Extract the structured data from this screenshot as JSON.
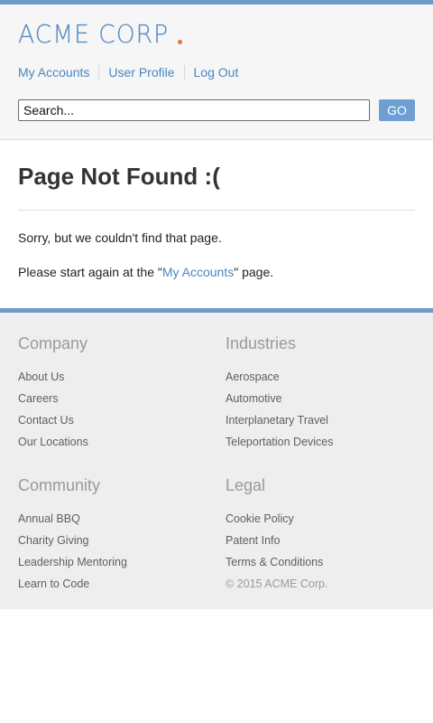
{
  "brand": {
    "name": "ACME CORP",
    "accent": "#6f9bc8",
    "dot_color": "#d9783a"
  },
  "nav": {
    "items": [
      "My Accounts",
      "User Profile",
      "Log Out"
    ]
  },
  "search": {
    "value": "Search...",
    "button_label": "GO"
  },
  "main": {
    "title": "Page Not Found :(",
    "message": "Sorry, but we couldn't find that page.",
    "restart_prefix": "Please start again at the \"",
    "restart_link": "My Accounts",
    "restart_suffix": "\" page."
  },
  "footer": {
    "company": {
      "title": "Company",
      "links": [
        "About Us",
        "Careers",
        "Contact Us",
        "Our Locations"
      ]
    },
    "industries": {
      "title": "Industries",
      "links": [
        "Aerospace",
        "Automotive",
        "Interplanetary Travel",
        "Teleportation Devices"
      ]
    },
    "community": {
      "title": "Community",
      "links": [
        "Annual BBQ",
        "Charity Giving",
        "Leadership Mentoring",
        "Learn to Code"
      ]
    },
    "legal": {
      "title": "Legal",
      "links": [
        "Cookie Policy",
        "Patent Info",
        "Terms & Conditions"
      ],
      "copyright": "© 2015 ACME Corp."
    }
  }
}
